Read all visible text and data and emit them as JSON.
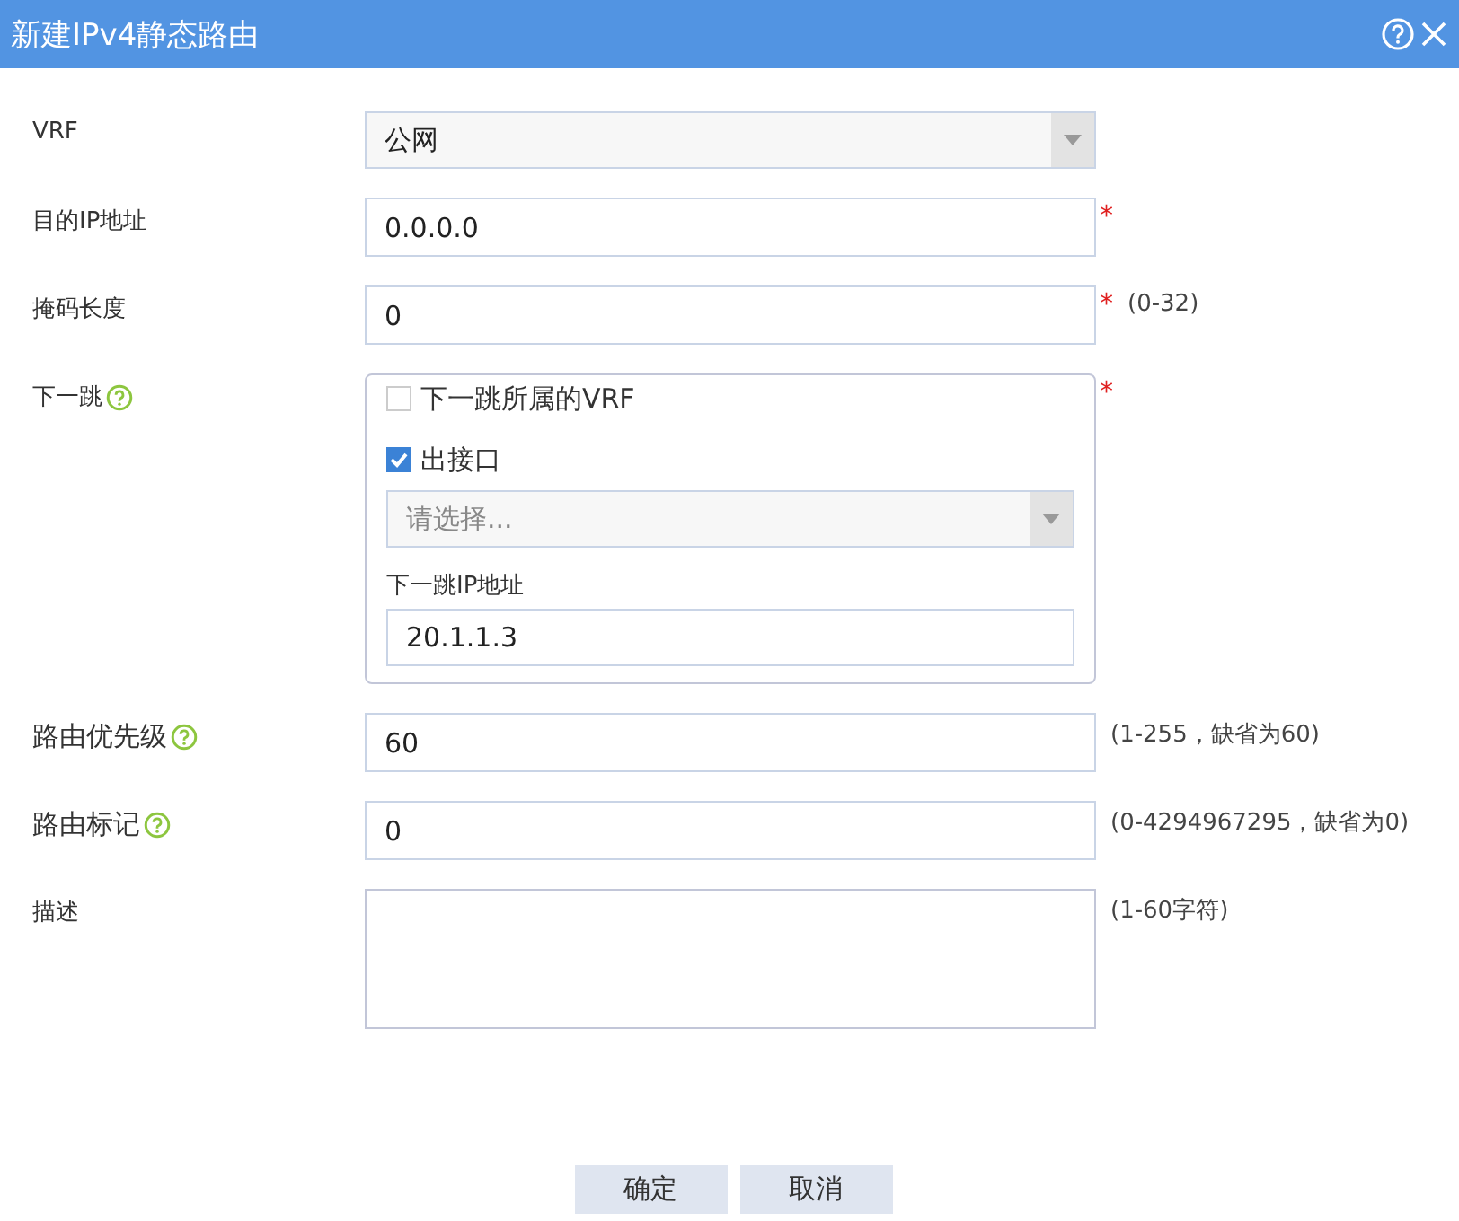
{
  "window": {
    "title": "新建IPv4静态路由"
  },
  "fields": [
    {
      "kind": "select",
      "label": "VRF",
      "help": false,
      "value": "公网"
    },
    {
      "kind": "input",
      "label": "目的IP地址",
      "help": false,
      "value": "0.0.0.0",
      "required_mark": "*"
    },
    {
      "kind": "input",
      "label": "掩码长度",
      "help": false,
      "value": "0",
      "required_mark": "*",
      "hint": "(0-32)"
    },
    {
      "kind": "nexthop",
      "label": "下一跳",
      "help": true,
      "required_mark": "*",
      "vrf_option": {
        "label": "下一跳所属的VRF",
        "checked": false
      },
      "interface_option": {
        "label": "出接口",
        "checked": true
      },
      "interface_select": {
        "placeholder": "请选择..."
      },
      "ip_label": "下一跳IP地址",
      "ip_value": "20.1.1.3"
    },
    {
      "kind": "input",
      "label": "路由优先级",
      "help": true,
      "value": "60",
      "hint": "(1-255，缺省为60)"
    },
    {
      "kind": "input",
      "label": "路由标记",
      "help": true,
      "value": "0",
      "hint": "(0-4294967295，缺省为0)"
    },
    {
      "kind": "textarea",
      "label": "描述",
      "help": false,
      "hint": "(1-60字符)"
    }
  ],
  "buttons": [
    "确定",
    "取消"
  ]
}
